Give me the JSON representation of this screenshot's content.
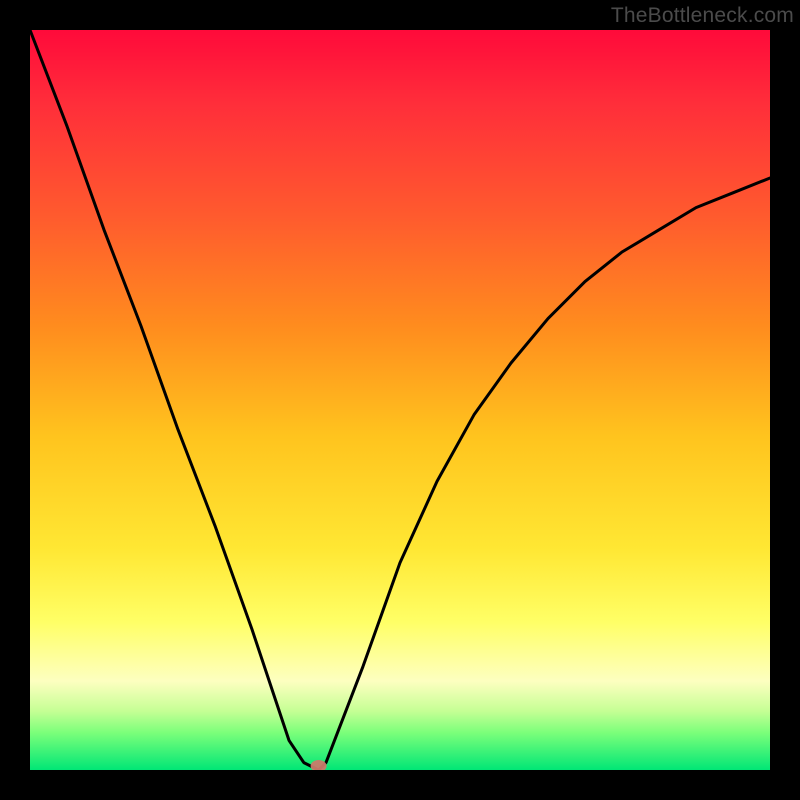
{
  "watermark": "TheBottleneck.com",
  "chart_data": {
    "type": "line",
    "title": "",
    "xlabel": "",
    "ylabel": "",
    "xlim": [
      0,
      100
    ],
    "ylim": [
      0,
      100
    ],
    "grid": false,
    "series": [
      {
        "name": "curve",
        "x": [
          0,
          5,
          10,
          15,
          20,
          25,
          30,
          33,
          35,
          37,
          39,
          40,
          45,
          50,
          55,
          60,
          65,
          70,
          75,
          80,
          85,
          90,
          95,
          100
        ],
        "values": [
          100,
          87,
          73,
          60,
          46,
          33,
          19,
          10,
          4,
          1,
          0,
          1,
          14,
          28,
          39,
          48,
          55,
          61,
          66,
          70,
          73,
          76,
          78,
          80
        ]
      }
    ],
    "marker": {
      "x": 39,
      "y": 0
    },
    "gradient_stops": [
      {
        "pos": 0,
        "color": "#ff0a3a"
      },
      {
        "pos": 25,
        "color": "#ff5a2e"
      },
      {
        "pos": 55,
        "color": "#ffc41e"
      },
      {
        "pos": 80,
        "color": "#ffff66"
      },
      {
        "pos": 95,
        "color": "#7aff7a"
      },
      {
        "pos": 100,
        "color": "#00e676"
      }
    ]
  }
}
